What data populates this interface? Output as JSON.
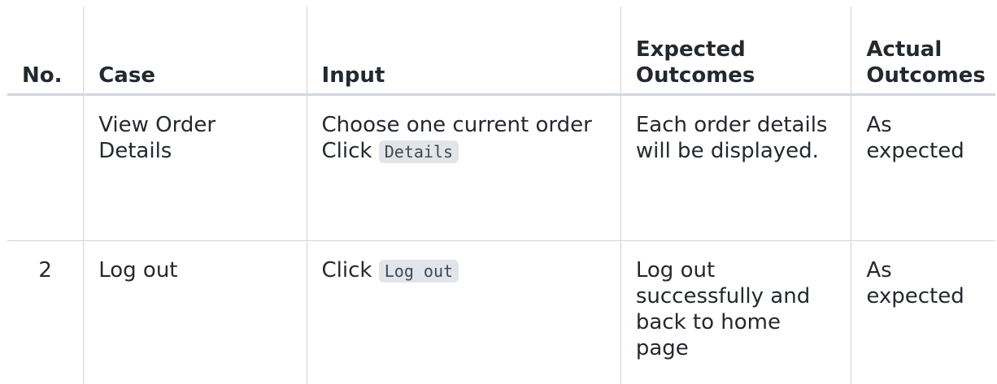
{
  "headers": {
    "no": "No.",
    "case": "Case",
    "input": "Input",
    "expected": "Expected Outcomes",
    "actual": "Actual Outcomes"
  },
  "rows": [
    {
      "no": "",
      "case": "View Order Details",
      "input_line1": "Choose one current order",
      "input_prefix": "Click",
      "input_code": "Details",
      "expected": "Each order details will be displayed.",
      "actual": "As expected"
    },
    {
      "no": "2",
      "case": "Log out",
      "input_prefix": "Click",
      "input_code": "Log out",
      "expected": "Log out successfully and back to home page",
      "actual": "As expected"
    }
  ]
}
